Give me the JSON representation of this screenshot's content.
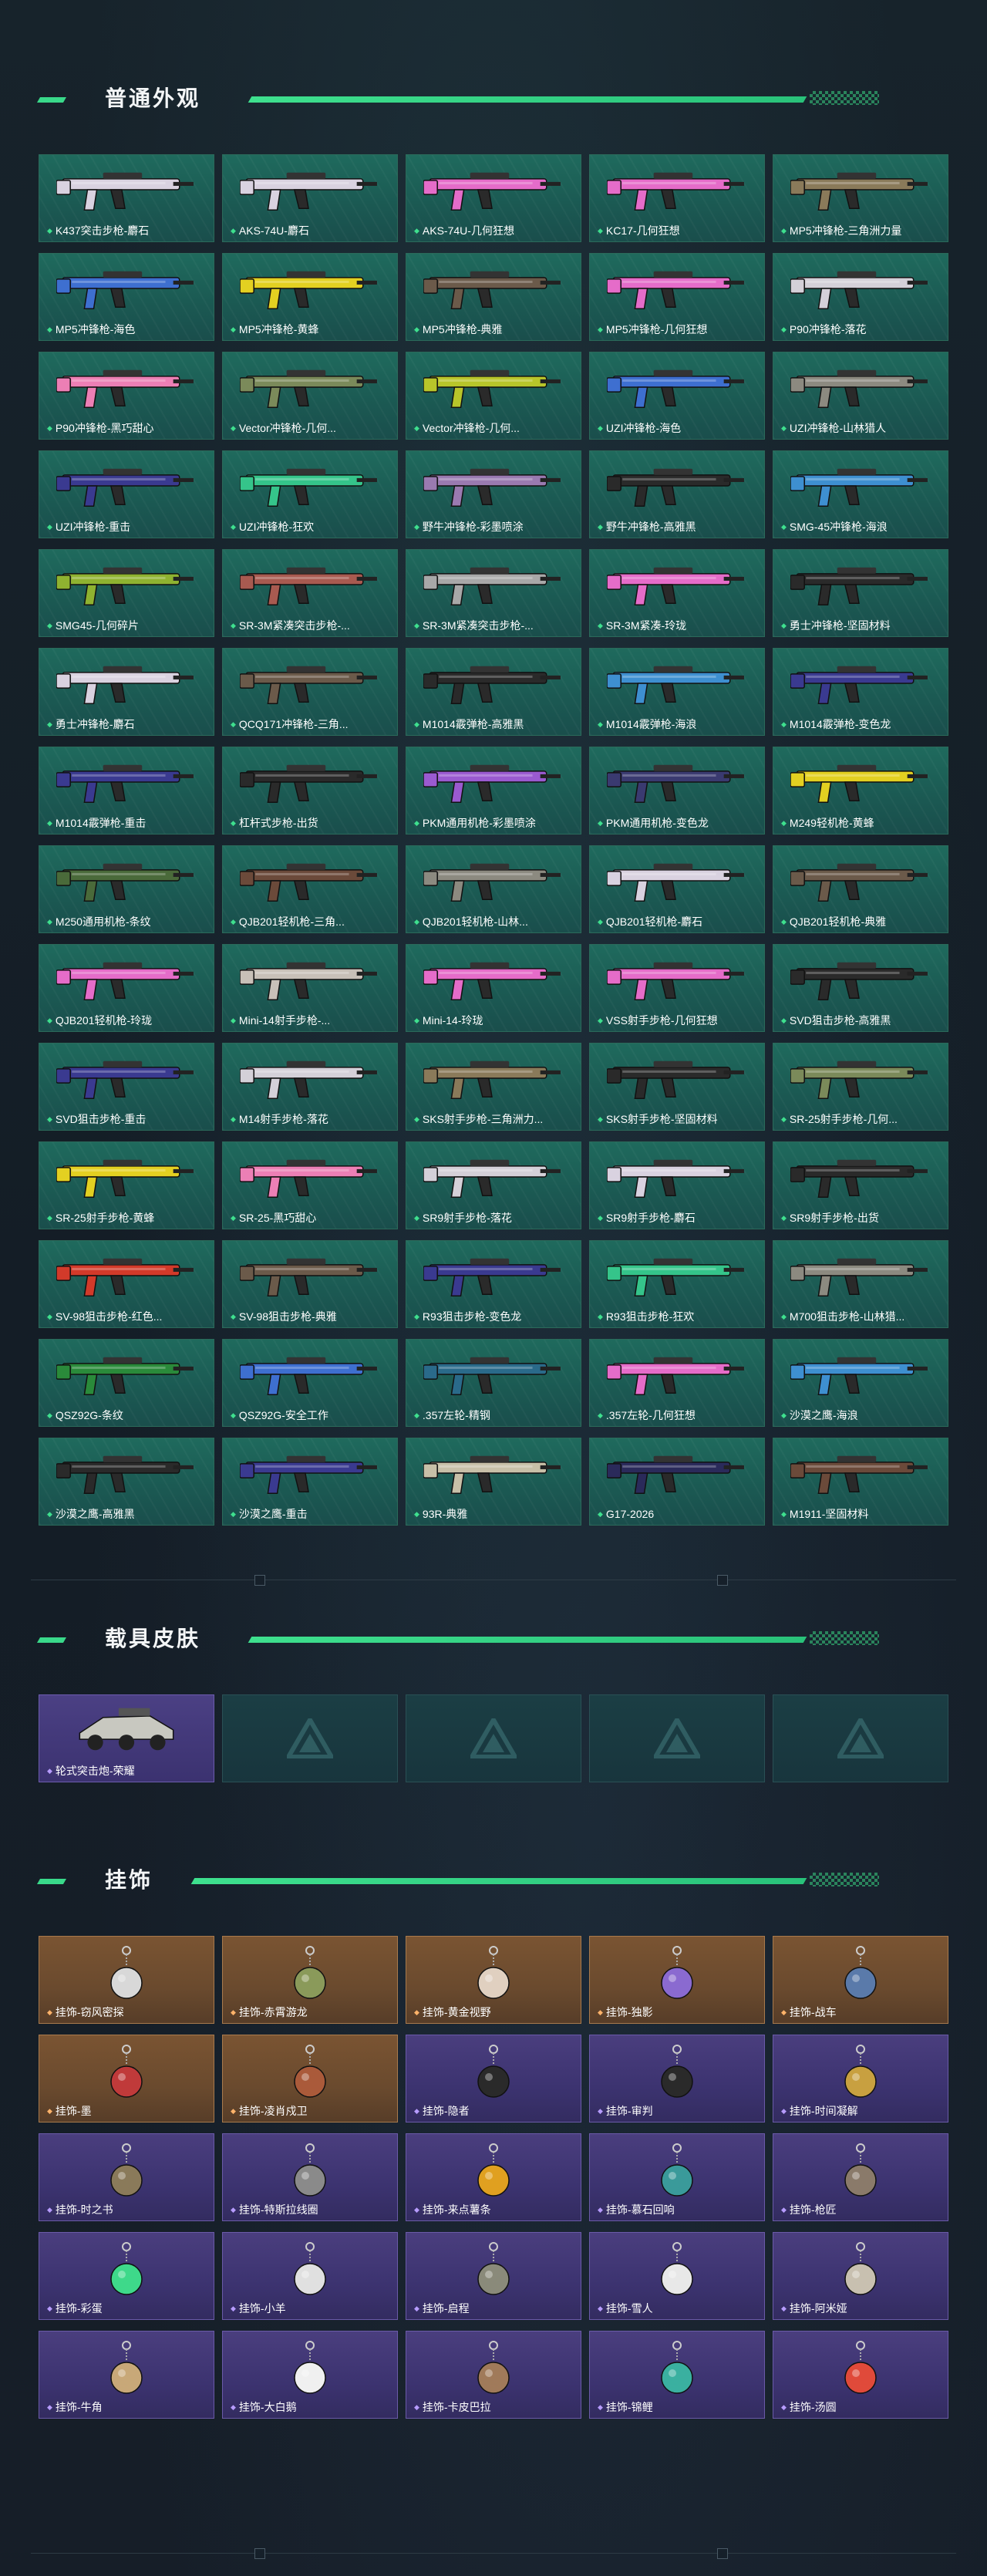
{
  "sections": {
    "weapons": {
      "title": "普通外观",
      "items": [
        {
          "label": "K437突击步枪-麝石",
          "color": "#d9d2e0"
        },
        {
          "label": "AKS-74U-麝石",
          "color": "#d9d2e0"
        },
        {
          "label": "AKS-74U-几何狂想",
          "color": "#e56cc9"
        },
        {
          "label": "KC17-几何狂想",
          "color": "#e56cc9"
        },
        {
          "label": "MP5冲锋枪-三角洲力量",
          "color": "#8a7a5a"
        },
        {
          "label": "MP5冲锋枪-海色",
          "color": "#3e6fd0"
        },
        {
          "label": "MP5冲锋枪-黄蜂",
          "color": "#e3d021"
        },
        {
          "label": "MP5冲锋枪-典雅",
          "color": "#6b5a4a"
        },
        {
          "label": "MP5冲锋枪-几何狂想",
          "color": "#e56cc9"
        },
        {
          "label": "P90冲锋枪-落花",
          "color": "#d4d0d8"
        },
        {
          "label": "P90冲锋枪-黑巧甜心",
          "color": "#ec7fb5"
        },
        {
          "label": "Vector冲锋枪-几何...",
          "color": "#7b8a5a"
        },
        {
          "label": "Vector冲锋枪-几何...",
          "color": "#b8c52a"
        },
        {
          "label": "UZI冲锋枪-海色",
          "color": "#3e6fd0"
        },
        {
          "label": "UZI冲锋枪-山林猎人",
          "color": "#8c8a80"
        },
        {
          "label": "UZI冲锋枪-重击",
          "color": "#3a3a90"
        },
        {
          "label": "UZI冲锋枪-狂欢",
          "color": "#35c48a"
        },
        {
          "label": "野牛冲锋枪-彩墨喷涂",
          "color": "#9a7ab0"
        },
        {
          "label": "野牛冲锋枪-高雅黑",
          "color": "#2a2a2a"
        },
        {
          "label": "SMG-45冲锋枪-海浪",
          "color": "#3e8fd0"
        },
        {
          "label": "SMG45-几何碎片",
          "color": "#8fb230"
        },
        {
          "label": "SR-3M紧凑突击步枪-...",
          "color": "#a85a50"
        },
        {
          "label": "SR-3M紧凑突击步枪-...",
          "color": "#a8a8a8"
        },
        {
          "label": "SR-3M紧凑-玲珑",
          "color": "#e56cc9"
        },
        {
          "label": "勇士冲锋枪-坚固材料",
          "color": "#2a2a2a"
        },
        {
          "label": "勇士冲锋枪-麝石",
          "color": "#d9d2e0"
        },
        {
          "label": "QCQ171冲锋枪-三角...",
          "color": "#6b5a4a"
        },
        {
          "label": "M1014霰弹枪-高雅黑",
          "color": "#2a2a2a"
        },
        {
          "label": "M1014霰弹枪-海浪",
          "color": "#3e8fd0"
        },
        {
          "label": "M1014霰弹枪-变色龙",
          "color": "#3a3a90"
        },
        {
          "label": "M1014霰弹枪-重击",
          "color": "#3a3a90"
        },
        {
          "label": "杠杆式步枪-出货",
          "color": "#2a2a2a"
        },
        {
          "label": "PKM通用机枪-彩墨喷涂",
          "color": "#9a5ad0"
        },
        {
          "label": "PKM通用机枪-变色龙",
          "color": "#3a3a70"
        },
        {
          "label": "M249轻机枪-黄蜂",
          "color": "#e3d021"
        },
        {
          "label": "M250通用机枪-条纹",
          "color": "#4a6a3a"
        },
        {
          "label": "QJB201轻机枪-三角...",
          "color": "#6b4a3a"
        },
        {
          "label": "QJB201轻机枪-山林...",
          "color": "#8c8a80"
        },
        {
          "label": "QJB201轻机枪-麝石",
          "color": "#d9d2e0"
        },
        {
          "label": "QJB201轻机枪-典雅",
          "color": "#6b5a4a"
        },
        {
          "label": "QJB201轻机枪-玲珑",
          "color": "#e56cc9"
        },
        {
          "label": "Mini-14射手步枪-...",
          "color": "#c8c0b8"
        },
        {
          "label": "Mini-14-玲珑",
          "color": "#e56cc9"
        },
        {
          "label": "VSS射手步枪-几何狂想",
          "color": "#e56cc9"
        },
        {
          "label": "SVD狙击步枪-高雅黑",
          "color": "#2a2a2a"
        },
        {
          "label": "SVD狙击步枪-重击",
          "color": "#3a3a90"
        },
        {
          "label": "M14射手步枪-落花",
          "color": "#d4d0d8"
        },
        {
          "label": "SKS射手步枪-三角洲力...",
          "color": "#8a7a5a"
        },
        {
          "label": "SKS射手步枪-坚固材料",
          "color": "#2a2a2a"
        },
        {
          "label": "SR-25射手步枪-几何...",
          "color": "#7b8a5a"
        },
        {
          "label": "SR-25射手步枪-黄蜂",
          "color": "#e3d021"
        },
        {
          "label": "SR-25-黑巧甜心",
          "color": "#ec7fb5"
        },
        {
          "label": "SR9射手步枪-落花",
          "color": "#d4d0d8"
        },
        {
          "label": "SR9射手步枪-麝石",
          "color": "#d9d2e0"
        },
        {
          "label": "SR9射手步枪-出货",
          "color": "#2a2a2a"
        },
        {
          "label": "SV-98狙击步枪-红色...",
          "color": "#d23a2a"
        },
        {
          "label": "SV-98狙击步枪-典雅",
          "color": "#6b5a4a"
        },
        {
          "label": "R93狙击步枪-变色龙",
          "color": "#3a3a90"
        },
        {
          "label": "R93狙击步枪-狂欢",
          "color": "#35c48a"
        },
        {
          "label": "M700狙击步枪-山林猎...",
          "color": "#8c8a80"
        },
        {
          "label": "QSZ92G-条纹",
          "color": "#2a8a3a"
        },
        {
          "label": "QSZ92G-安全工作",
          "color": "#3e6fd0"
        },
        {
          "label": ".357左轮-精钢",
          "color": "#2a6a8a"
        },
        {
          "label": ".357左轮-几何狂想",
          "color": "#e56cc9"
        },
        {
          "label": "沙漠之鹰-海浪",
          "color": "#3e8fd0"
        },
        {
          "label": "沙漠之鹰-高雅黑",
          "color": "#2a2a2a"
        },
        {
          "label": "沙漠之鹰-重击",
          "color": "#3a3a90"
        },
        {
          "label": "93R-典雅",
          "color": "#c8c0a8"
        },
        {
          "label": "G17-2026",
          "color": "#2a2a5a"
        },
        {
          "label": "M1911-坚固材料",
          "color": "#6b4a3a"
        }
      ]
    },
    "vehicles": {
      "title": "载具皮肤",
      "items": [
        {
          "label": "轮式突击炮-荣耀",
          "color": "#c8c8c0"
        }
      ],
      "empty_slots": 4
    },
    "charms": {
      "title": "挂饰",
      "items": [
        {
          "label": "挂饰-窃风密探",
          "rarity": "orange",
          "color": "#d8d8d8"
        },
        {
          "label": "挂饰-赤霄游龙",
          "rarity": "orange",
          "color": "#8a9a5a"
        },
        {
          "label": "挂饰-黄金视野",
          "rarity": "orange",
          "color": "#e0d0c0"
        },
        {
          "label": "挂饰-独影",
          "rarity": "orange",
          "color": "#8a6ad0"
        },
        {
          "label": "挂饰-战车",
          "rarity": "orange",
          "color": "#5a7aaa"
        },
        {
          "label": "挂饰-墨",
          "rarity": "orange",
          "color": "#c03a3a"
        },
        {
          "label": "挂饰-凌肖戍卫",
          "rarity": "orange",
          "color": "#aa5a3a"
        },
        {
          "label": "挂饰-隐者",
          "rarity": "purple",
          "color": "#2a2a2a"
        },
        {
          "label": "挂饰-审判",
          "rarity": "purple",
          "color": "#2a2a2a"
        },
        {
          "label": "挂饰-时间凝解",
          "rarity": "purple",
          "color": "#c8a040"
        },
        {
          "label": "挂饰-时之书",
          "rarity": "purple",
          "color": "#8a7a5a"
        },
        {
          "label": "挂饰-特斯拉线圈",
          "rarity": "purple",
          "color": "#8a8a8a"
        },
        {
          "label": "挂饰-来点薯条",
          "rarity": "purple",
          "color": "#e0a020"
        },
        {
          "label": "挂饰-慕石回响",
          "rarity": "purple",
          "color": "#3a9a9a"
        },
        {
          "label": "挂饰-枪匠",
          "rarity": "purple",
          "color": "#8a7a6a"
        },
        {
          "label": "挂饰-彩蛋",
          "rarity": "purple",
          "color": "#3ed98a"
        },
        {
          "label": "挂饰-小羊",
          "rarity": "purple",
          "color": "#e0e0e0"
        },
        {
          "label": "挂饰-启程",
          "rarity": "purple",
          "color": "#8a8a7a"
        },
        {
          "label": "挂饰-雪人",
          "rarity": "purple",
          "color": "#e8e8e8"
        },
        {
          "label": "挂饰-阿米娅",
          "rarity": "purple",
          "color": "#c8c0b0"
        },
        {
          "label": "挂饰-牛角",
          "rarity": "purple",
          "color": "#c8a878"
        },
        {
          "label": "挂饰-大白鹅",
          "rarity": "purple",
          "color": "#f0f0f0"
        },
        {
          "label": "挂饰-卡皮巴拉",
          "rarity": "purple",
          "color": "#a07a5a"
        },
        {
          "label": "挂饰-锦鲤",
          "rarity": "purple",
          "color": "#3ab0a0"
        },
        {
          "label": "挂饰-汤圆",
          "rarity": "purple",
          "color": "#e04a3a"
        }
      ]
    }
  }
}
